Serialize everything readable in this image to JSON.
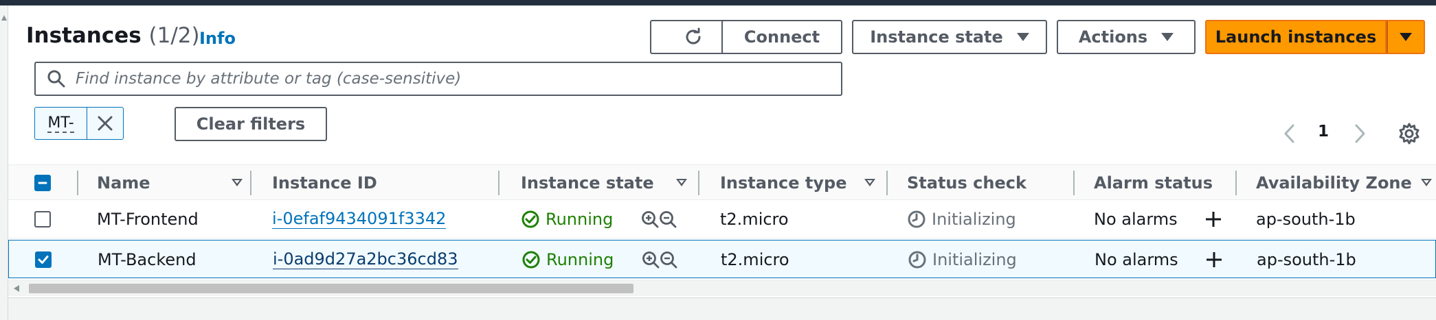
{
  "header": {
    "title": "Instances",
    "count": "(1/2)",
    "info_label": "Info"
  },
  "toolbar": {
    "refresh_icon": "refresh-icon",
    "connect_label": "Connect",
    "instance_state_label": "Instance state",
    "actions_label": "Actions",
    "launch_label": "Launch instances"
  },
  "search": {
    "placeholder": "Find instance by attribute or tag (case-sensitive)",
    "value": ""
  },
  "filters": {
    "token_label": "MT-",
    "clear_label": "Clear filters"
  },
  "pagination": {
    "current_page": "1"
  },
  "table": {
    "columns": [
      "Name",
      "Instance ID",
      "Instance state",
      "Instance type",
      "Status check",
      "Alarm status",
      "Availability Zone"
    ],
    "rows": [
      {
        "selected": false,
        "name": "MT-Frontend",
        "instance_id": "i-0efaf9434091f3342",
        "instance_state": "Running",
        "instance_type": "t2.micro",
        "status_check": "Initializing",
        "alarm_status": "No alarms",
        "availability_zone": "ap-south-1b"
      },
      {
        "selected": true,
        "name": "MT-Backend",
        "instance_id": "i-0ad9d27a2bc36cd83",
        "instance_state": "Running",
        "instance_type": "t2.micro",
        "status_check": "Initializing",
        "alarm_status": "No alarms",
        "availability_zone": "ap-south-1b"
      }
    ]
  },
  "colors": {
    "accent": "#0073bb",
    "launch": "#ff9900",
    "running": "#1d8102",
    "topbar": "#232f3e"
  }
}
